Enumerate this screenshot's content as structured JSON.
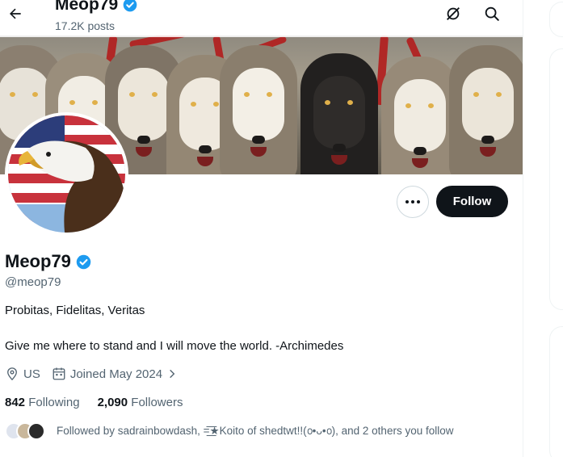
{
  "header": {
    "title": "Meop79",
    "posts_count": "17.2K posts"
  },
  "profile": {
    "name": "Meop79",
    "handle": "@meop79",
    "bio": "Probitas, Fidelitas, Veritas",
    "quote": "Give me where to stand and I will move the world. -Archimedes",
    "location": "US",
    "joined": "Joined May 2024",
    "following_count": "842",
    "following_label": "Following",
    "followers_count": "2,090",
    "followers_label": "Followers",
    "followed_by": "Followed by sadrainbowdash, =͟͟͞͞★Koito of shedtwt!!(൦•ᴗ•൦), and 2 others you follow"
  },
  "actions": {
    "follow_label": "Follow"
  },
  "icons": [
    "back-arrow-icon",
    "verified-badge-icon",
    "mute-icon",
    "search-icon",
    "more-icon",
    "location-icon",
    "calendar-icon",
    "chevron-right-icon"
  ],
  "colors": {
    "verified": "#1d9bf0",
    "text_secondary": "#536471",
    "follow_button": "#0f1419"
  }
}
